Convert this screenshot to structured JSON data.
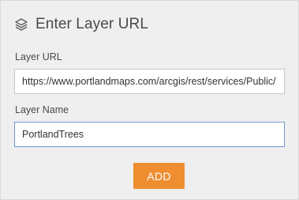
{
  "header": {
    "icon": "layers-icon",
    "title": "Enter Layer URL"
  },
  "layer_url": {
    "label": "Layer URL",
    "value": "https://www.portlandmaps.com/arcgis/rest/services/Public/"
  },
  "layer_name": {
    "label": "Layer Name",
    "value": "PortlandTrees"
  },
  "actions": {
    "add_label": "ADD"
  },
  "colors": {
    "panel_background": "#efefef",
    "add_button": "#ee8e30",
    "focused_border": "#6f9ad4"
  }
}
